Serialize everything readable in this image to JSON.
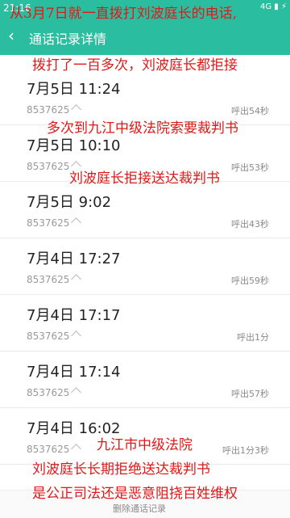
{
  "status_bar": {
    "time": "21:16",
    "icons": "4G ▮ ⚡"
  },
  "header": {
    "title": "通话记录详情"
  },
  "records": [
    {
      "time": "7月5日 11:24",
      "number": "8537625",
      "duration": "呼出54秒"
    },
    {
      "time": "7月5日 10:10",
      "number": "8537625",
      "duration": "呼出53秒"
    },
    {
      "time": "7月5日 9:02",
      "number": "8537625",
      "duration": "呼出43秒"
    },
    {
      "time": "7月4日 17:27",
      "number": "8537625",
      "duration": "呼出59秒"
    },
    {
      "time": "7月4日 17:17",
      "number": "8537625",
      "duration": "呼出1分"
    },
    {
      "time": "7月4日 17:14",
      "number": "8537625",
      "duration": "呼出57秒"
    },
    {
      "time": "7月4日 16:02",
      "number": "8537625",
      "duration": "呼出1分3秒"
    }
  ],
  "bottom": {
    "delete_label": "删除通话记录"
  },
  "overlay_text": [
    "从3月7日就一直拨打刘波庭长的电话,",
    "拨打了一百多次，刘波庭长都拒接",
    "多次到九江中级法院索要裁判书",
    "刘波庭长拒接送达裁判书",
    "九江市中级法院",
    "刘波庭长长期拒绝送达裁判书",
    "是公正司法还是恶意阻挠百姓维权"
  ],
  "colors": {
    "accent": "#2bbd9f",
    "overlay": "#e01818"
  }
}
